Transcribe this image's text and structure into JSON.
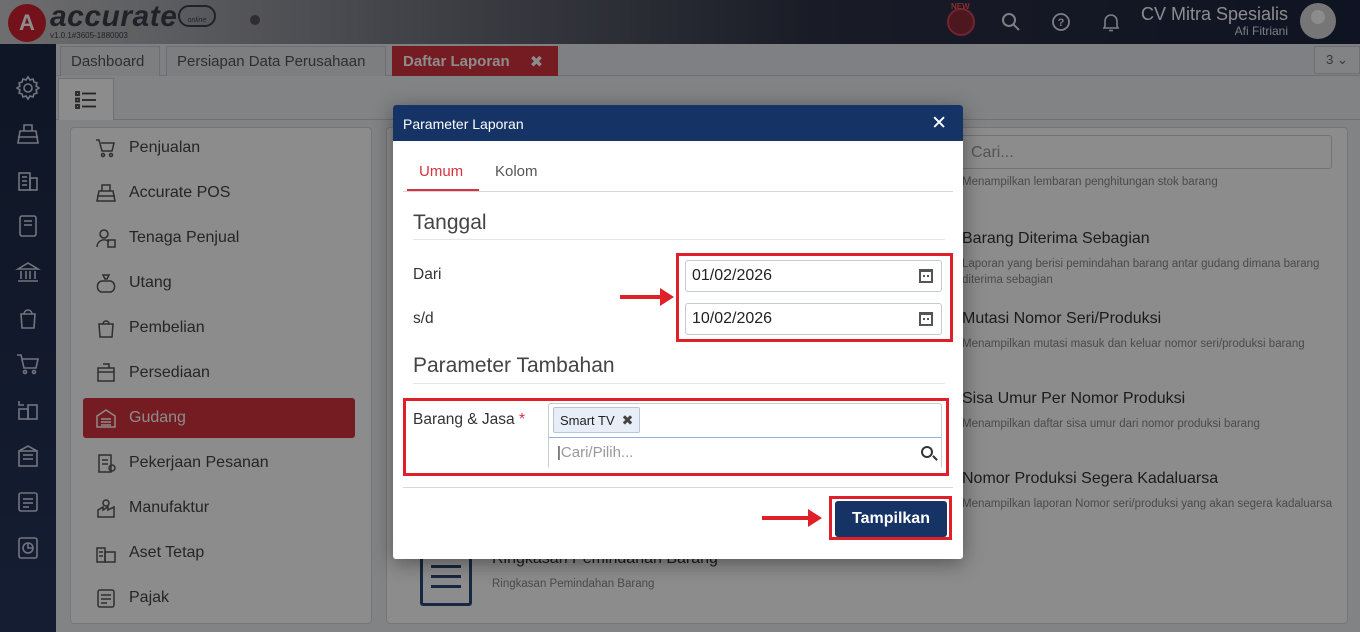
{
  "app": {
    "logo_word": "accurate",
    "logo_version": "v1.0.1#3605-1880003",
    "logo_cloud": "online",
    "new_badge": "NEW",
    "company_name": "CV Mitra Spesialis",
    "user_name": "Afi Fitriani"
  },
  "tabs": [
    {
      "label": "Dashboard"
    },
    {
      "label": "Persiapan Data Perusahaan"
    },
    {
      "label": "Daftar Laporan",
      "close": "✖"
    }
  ],
  "tab_count": "3 ⌄",
  "menu": {
    "items": [
      {
        "label": "Penjualan"
      },
      {
        "label": "Accurate POS"
      },
      {
        "label": "Tenaga Penjual"
      },
      {
        "label": "Utang"
      },
      {
        "label": "Pembelian"
      },
      {
        "label": "Persediaan"
      },
      {
        "label": "Gudang",
        "active": true
      },
      {
        "label": "Pekerjaan Pesanan"
      },
      {
        "label": "Manufaktur"
      },
      {
        "label": "Aset Tetap"
      },
      {
        "label": "Pajak"
      }
    ]
  },
  "content": {
    "search_placeholder": "Cari...",
    "reports": [
      {
        "title": "",
        "desc": "Menampilkan lembaran penghitungan stok barang"
      },
      {
        "title": "Barang Diterima Sebagian",
        "desc": "Laporan yang berisi pemindahan barang antar gudang dimana barang diterima sebagian"
      },
      {
        "title": "Mutasi Nomor Seri/Produksi",
        "desc": "Menampilkan mutasi masuk dan keluar nomor seri/produksi barang"
      },
      {
        "title": "Sisa Umur Per Nomor Produksi",
        "desc": "Menampilkan daftar sisa umur dari nomor produksi barang"
      },
      {
        "title": "Nomor Produksi Segera Kadaluarsa",
        "desc": "Menampilkan laporan Nomor seri/produksi yang akan segera kadaluarsa"
      }
    ],
    "bottom_report": {
      "title": "Ringkasan Pemindahan Barang",
      "desc": "Ringkasan Pemindahan Barang"
    }
  },
  "modal": {
    "title": "Parameter Laporan",
    "close": "✕",
    "tabs": [
      {
        "label": "Umum",
        "active": true
      },
      {
        "label": "Kolom"
      }
    ],
    "section_date": "Tanggal",
    "from_label": "Dari",
    "from_value": "01/02/2026",
    "to_label": "s/d",
    "to_value": "10/02/2026",
    "section_extra": "Parameter Tambahan",
    "items_label": "Barang & Jasa",
    "items_required": "*",
    "selected_items": [
      "Smart TV"
    ],
    "items_search_placeholder": "Cari/Pilih...",
    "submit_label": "Tampilkan"
  },
  "colors": {
    "accent_red": "#d6333f",
    "navy": "#163366",
    "annotation_red": "#e02028"
  }
}
